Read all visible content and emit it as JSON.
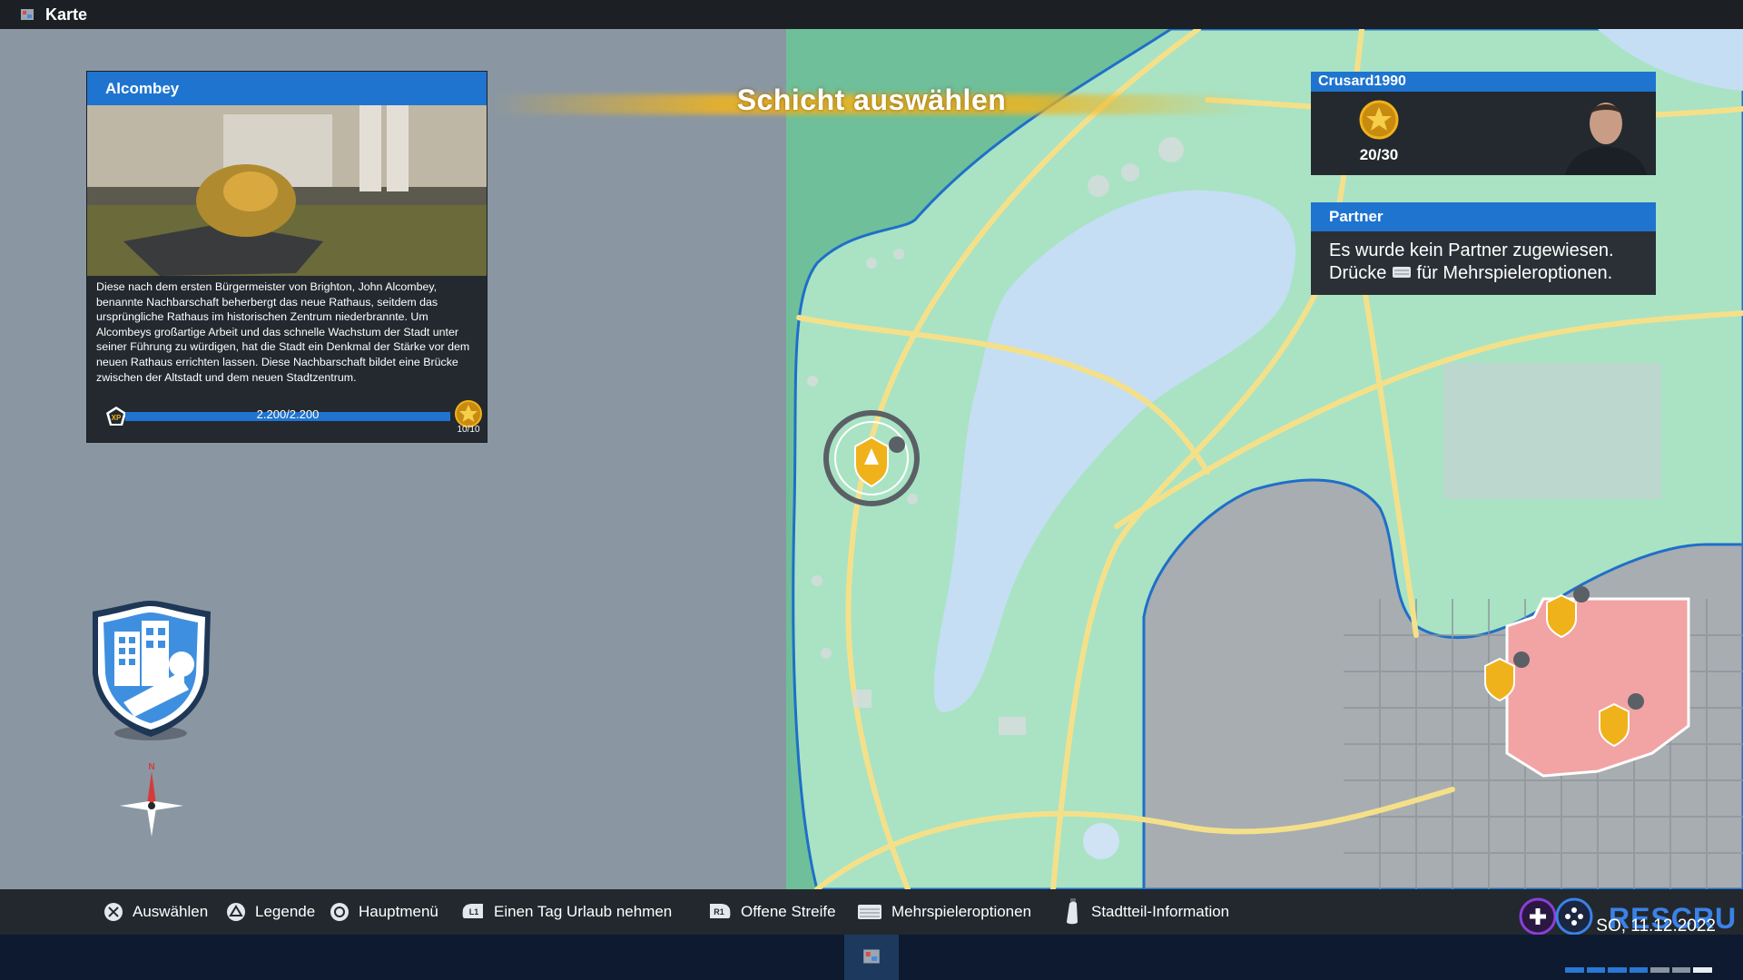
{
  "window": {
    "title": "Karte",
    "icon": "map-app-icon"
  },
  "district": {
    "name": "Alcombey",
    "description": "Diese nach dem ersten Bürgermeister von Brighton, John Alcombey, benannte Nachbarschaft beherbergt das neue Rathaus, seitdem das ursprüngliche Rathaus im historischen Zentrum niederbrannte. Um Alcombeys großartige Arbeit und das schnelle Wachstum der Stadt unter seiner Führung zu würdigen, hat die Stadt ein Denkmal der Stärke vor dem neuen Rathaus errichten lassen. Diese Nachbarschaft bildet eine Brücke zwischen der Altstadt und dem neuen Stadtzentrum.",
    "xp_badge": "XP",
    "xp_text": "2.200/2.200",
    "xp_progress": 1.0,
    "level_text": "10/10"
  },
  "banner": {
    "text": "Schicht auswählen"
  },
  "player": {
    "name": "Crusard1990",
    "rank_text": "20/30",
    "rank_icon": "star-rank-icon"
  },
  "partner": {
    "title": "Partner",
    "line1": "Es wurde kein Partner zugewiesen.",
    "line2_pre": "Drücke",
    "line2_post": "für Mehrspieleroptionen."
  },
  "hints": [
    {
      "button": "cross-button-icon",
      "label": "Auswählen"
    },
    {
      "button": "triangle-button-icon",
      "label": "Legende"
    },
    {
      "button": "circle-button-icon",
      "label": "Hauptmenü"
    },
    {
      "button": "l1-button-icon",
      "button_text": "L1",
      "label": "Einen Tag Urlaub nehmen"
    },
    {
      "button": "r1-button-icon",
      "button_text": "R1",
      "label": "Offene Streife"
    },
    {
      "button": "touchpad-button-icon",
      "label": "Mehrspieleroptionen"
    },
    {
      "button": "right-stick-icon",
      "label": "Stadtteil-Information"
    }
  ],
  "logo": {
    "text": "RESCRU"
  },
  "clock": {
    "date": "SO, 11.12.2022"
  },
  "compass": {
    "north_label": "N"
  },
  "colors": {
    "accent_blue": "#1f74d0",
    "map_green": "#a9e3c4",
    "water": "#c5def3",
    "road": "#f5e08a",
    "marker_gold": "#f0b21a",
    "district_red": "#f2a3a3"
  }
}
